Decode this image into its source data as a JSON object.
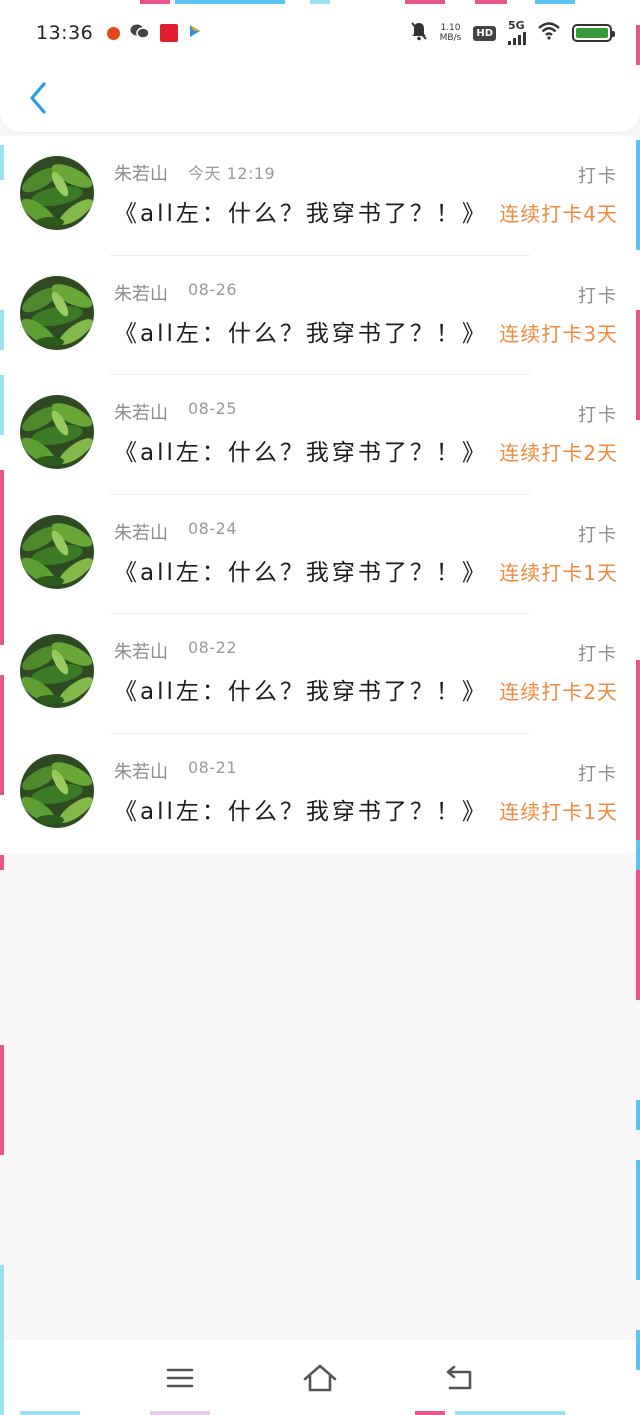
{
  "status_bar": {
    "time": "13:36",
    "net_speed_value": "1.10",
    "net_speed_unit": "MB/s",
    "hd_label": "HD",
    "signal_label": "5G",
    "icons": [
      "weather-icon",
      "wechat-icon",
      "app-icon",
      "app-icon-2",
      "mute-bell-icon",
      "wifi-icon",
      "battery-icon"
    ]
  },
  "header": {
    "back_icon": "chevron-left-icon"
  },
  "colors": {
    "accent": "#2d9be0",
    "streak": "#ee8a3c",
    "meta": "#8e8e8e"
  },
  "items": [
    {
      "user": "朱若山",
      "date": "今天 12:19",
      "title": "《all左：什么？我穿书了？！》",
      "type": "打卡",
      "streak": "连续打卡4天"
    },
    {
      "user": "朱若山",
      "date": "08-26",
      "title": "《all左：什么？我穿书了？！》",
      "type": "打卡",
      "streak": "连续打卡3天"
    },
    {
      "user": "朱若山",
      "date": "08-25",
      "title": "《all左：什么？我穿书了？！》",
      "type": "打卡",
      "streak": "连续打卡2天"
    },
    {
      "user": "朱若山",
      "date": "08-24",
      "title": "《all左：什么？我穿书了？！》",
      "type": "打卡",
      "streak": "连续打卡1天"
    },
    {
      "user": "朱若山",
      "date": "08-22",
      "title": "《all左：什么？我穿书了？！》",
      "type": "打卡",
      "streak": "连续打卡2天"
    },
    {
      "user": "朱若山",
      "date": "08-21",
      "title": "《all左：什么？我穿书了？！》",
      "type": "打卡",
      "streak": "连续打卡1天"
    }
  ],
  "nav": {
    "icons": [
      "menu-icon",
      "home-icon",
      "back-icon"
    ]
  }
}
